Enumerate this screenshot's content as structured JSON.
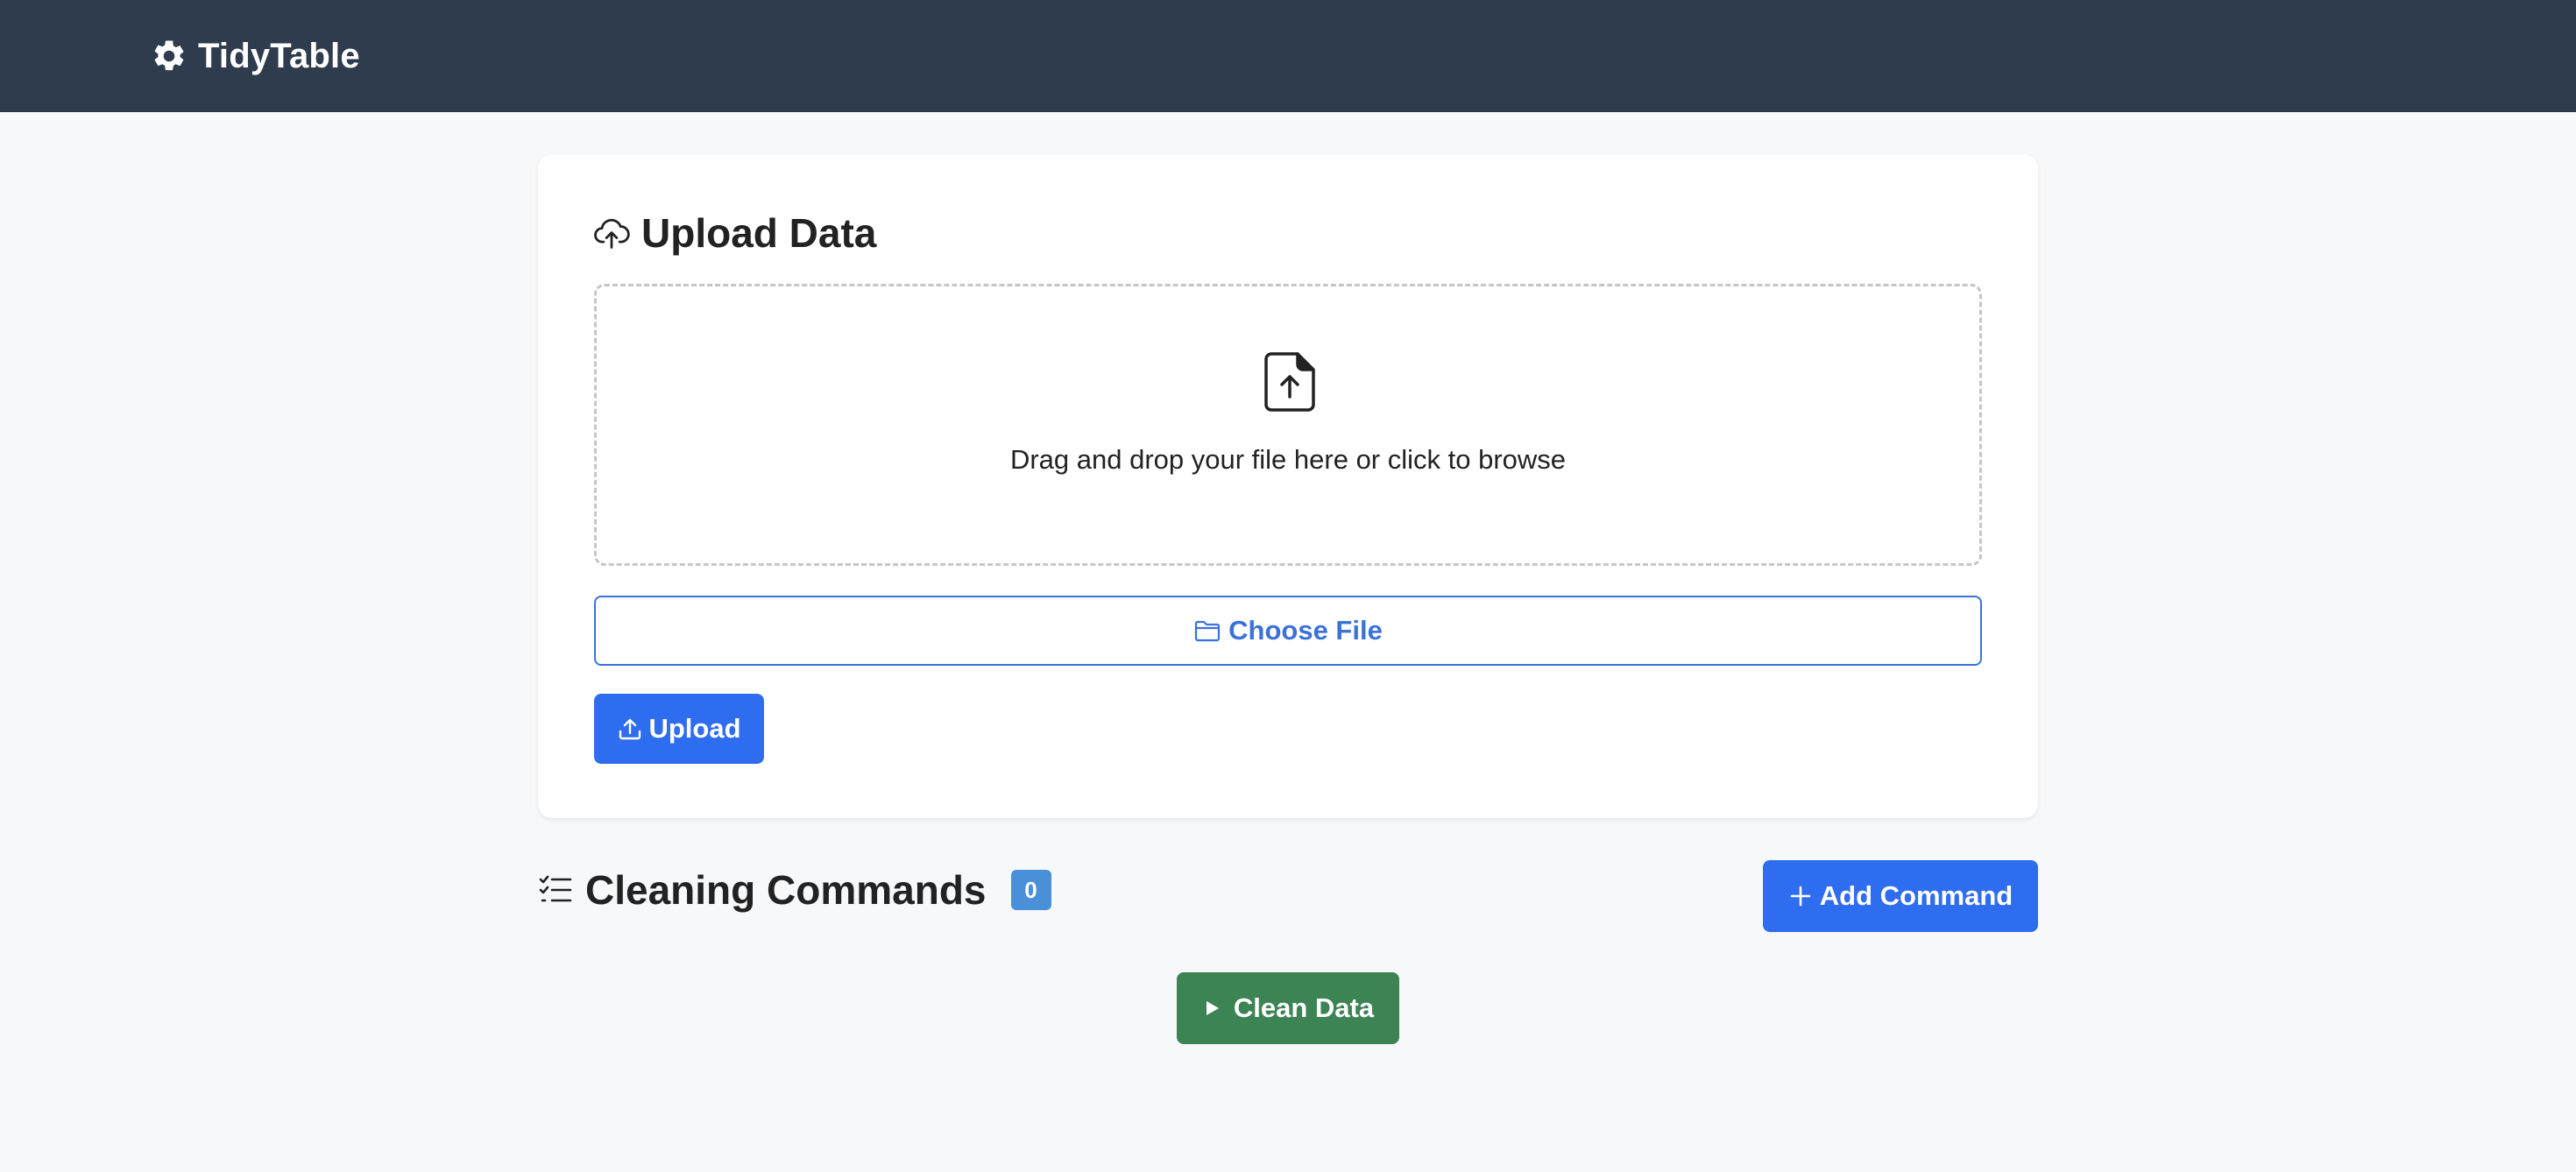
{
  "navbar": {
    "brand_icon": "gear-icon",
    "brand_name": "TidyTable",
    "background": "#2f3c4e"
  },
  "upload_card": {
    "title_icon": "cloud-upload-icon",
    "title": "Upload Data",
    "dropzone": {
      "icon": "file-upload-icon",
      "text": "Drag and drop your file here or click to browse"
    },
    "choose_file": {
      "icon": "folder-icon",
      "label": "Choose File"
    },
    "upload_button": {
      "icon": "upload-icon",
      "label": "Upload"
    }
  },
  "commands": {
    "icon": "checklist-icon",
    "title": "Cleaning Commands",
    "count": "0",
    "add_button": {
      "icon": "plus-icon",
      "label": "Add Command"
    },
    "clean_button": {
      "icon": "play-icon",
      "label": "Clean Data"
    }
  },
  "colors": {
    "primary": "#2f6df0",
    "outline": "#3b72d8",
    "success": "#3d8455",
    "badge": "#4a90d9",
    "page_background": "#f7f8fa"
  }
}
